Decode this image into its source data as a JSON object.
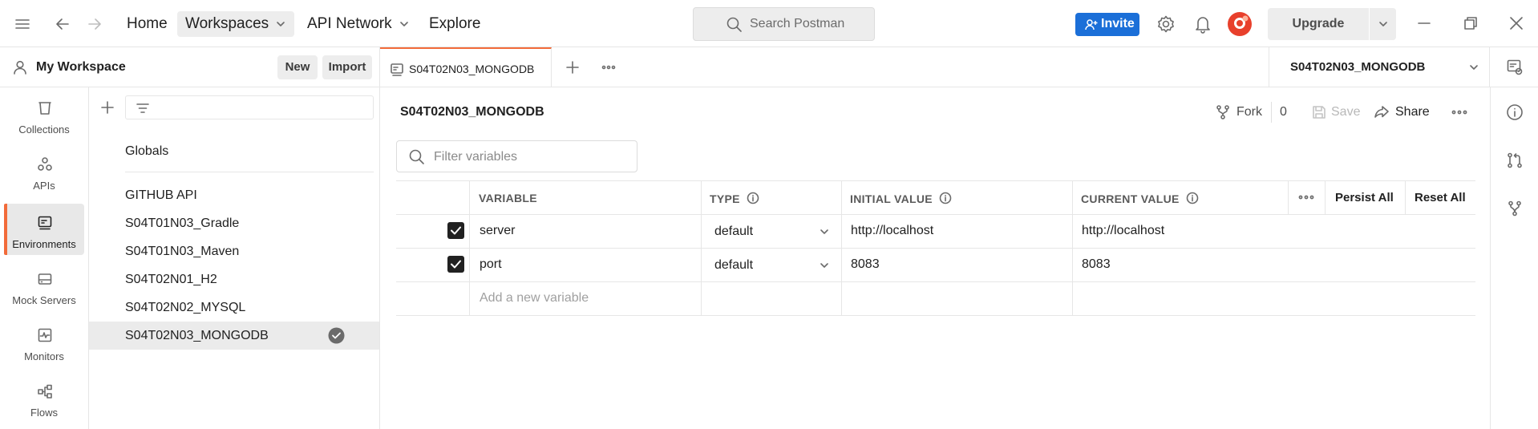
{
  "nav": {
    "home": "Home",
    "workspaces": "Workspaces",
    "api_network": "API Network",
    "explore": "Explore"
  },
  "search": {
    "placeholder": "Search Postman"
  },
  "header_actions": {
    "invite": "Invite",
    "upgrade": "Upgrade"
  },
  "colors": {
    "accent": "#f26b3a",
    "invite_blue": "#1b6fd8"
  },
  "sidebar": {
    "workspace_name": "My Workspace",
    "new_label": "New",
    "import_label": "Import",
    "rail": [
      {
        "label": "Collections",
        "icon": "collections-icon"
      },
      {
        "label": "APIs",
        "icon": "apis-icon"
      },
      {
        "label": "Environments",
        "icon": "environments-icon",
        "active": true
      },
      {
        "label": "Mock Servers",
        "icon": "mock-servers-icon"
      },
      {
        "label": "Monitors",
        "icon": "monitors-icon"
      },
      {
        "label": "Flows",
        "icon": "flows-icon"
      }
    ],
    "globals": "Globals",
    "environments": [
      "GITHUB API",
      "S04T01N03_Gradle",
      "S04T01N03_Maven",
      "S04T02N01_H2",
      "S04T02N02_MYSQL",
      "S04T02N03_MONGODB"
    ]
  },
  "tabs": {
    "active_tab": "S04T02N03_MONGODB",
    "env_selector": "S04T02N03_MONGODB"
  },
  "environment": {
    "title": "S04T02N03_MONGODB",
    "fork_label": "Fork",
    "fork_count": "0",
    "save_label": "Save",
    "share_label": "Share",
    "filter_placeholder": "Filter variables"
  },
  "table": {
    "headers": {
      "variable": "VARIABLE",
      "type": "TYPE",
      "initial": "INITIAL VALUE",
      "current": "CURRENT VALUE"
    },
    "persist_all": "Persist All",
    "reset_all": "Reset All",
    "rows": [
      {
        "variable": "server",
        "type": "default",
        "initial": "http://localhost",
        "current": "http://localhost",
        "enabled": true
      },
      {
        "variable": "port",
        "type": "default",
        "initial": "8083",
        "current": "8083",
        "enabled": true
      }
    ],
    "add_placeholder": "Add a new variable"
  }
}
